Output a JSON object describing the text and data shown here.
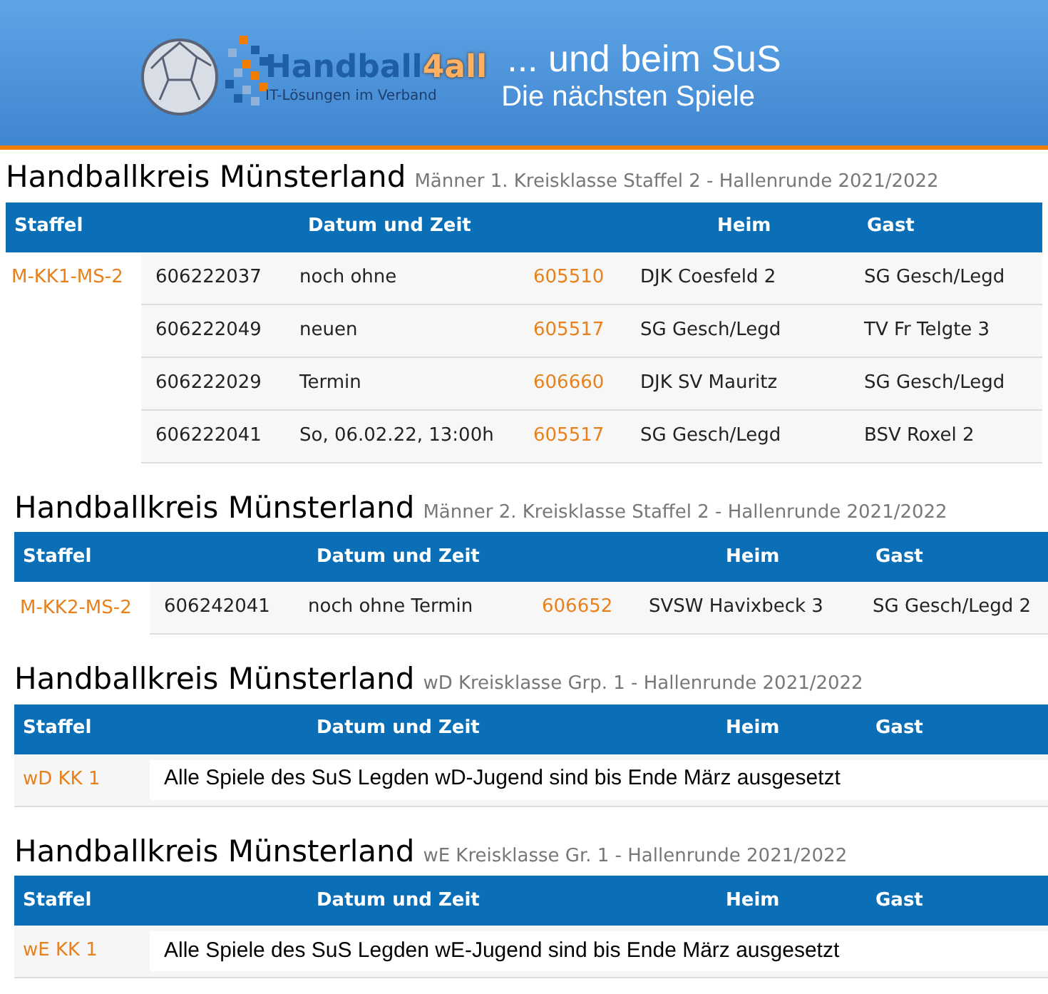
{
  "header": {
    "logo": {
      "name": "Handball",
      "accent": "4all",
      "tagline": "IT-Lösungen im Verband"
    },
    "title": "... und beim SuS",
    "subtitle": "Die nächsten Spiele"
  },
  "sections": [
    {
      "title": "Handballkreis Münsterland",
      "subtitle": "Männer 1. Kreisklasse Staffel 2 - Hallenrunde 2021/2022",
      "columns": [
        "Staffel",
        "Datum und Zeit",
        "Heim",
        "Gast"
      ],
      "rows": [
        {
          "kind": "game",
          "staffel": "M-KK1-MS-2",
          "nr": "606222037",
          "date": "noch ohne",
          "home_nr": "605510",
          "home": "DJK Coesfeld 2",
          "guest": "SG Gesch/Legd"
        },
        {
          "kind": "game",
          "nr": "606222049",
          "date": "neuen",
          "home_nr": "605517",
          "home": "SG Gesch/Legd",
          "guest": "TV Fr Telgte 3"
        },
        {
          "kind": "game",
          "nr": "606222029",
          "date": "Termin",
          "home_nr": "606660",
          "home": "DJK SV Mauritz",
          "guest": "SG Gesch/Legd"
        },
        {
          "kind": "game",
          "nr": "606222041",
          "date": "So, 06.02.22, 13:00h",
          "home_nr": "605517",
          "home": "SG Gesch/Legd",
          "guest": "BSV Roxel 2"
        }
      ]
    },
    {
      "title": "Handballkreis Münsterland",
      "subtitle": "Männer 2. Kreisklasse Staffel 2 - Hallenrunde 2021/2022",
      "columns": [
        "Staffel",
        "Datum und Zeit",
        "Heim",
        "Gast"
      ],
      "rows": [
        {
          "kind": "game",
          "staffel": "M-KK2-MS-2",
          "nr": "606242041",
          "date": "noch ohne Termin",
          "home_nr": "606652",
          "home": "SVSW Havixbeck 3",
          "guest": "SG Gesch/Legd 2"
        }
      ]
    },
    {
      "title": "Handballkreis Münsterland",
      "subtitle": "wD Kreisklasse Grp. 1 - Hallenrunde 2021/2022",
      "columns": [
        "Staffel",
        "Datum und Zeit",
        "Heim",
        "Gast"
      ],
      "rows": [
        {
          "kind": "notice",
          "staffel": "wD KK 1",
          "text": "Alle Spiele des SuS Legden wD-Jugend sind bis Ende März ausgesetzt"
        }
      ]
    },
    {
      "title": "Handballkreis Münsterland",
      "subtitle": "wE Kreisklasse Gr. 1 - Hallenrunde 2021/2022",
      "columns": [
        "Staffel",
        "Datum und Zeit",
        "Heim",
        "Gast"
      ],
      "rows": [
        {
          "kind": "notice",
          "staffel": "wE KK 1",
          "text": "Alle Spiele des SuS Legden wE-Jugend sind bis Ende März ausgesetzt"
        }
      ]
    }
  ]
}
